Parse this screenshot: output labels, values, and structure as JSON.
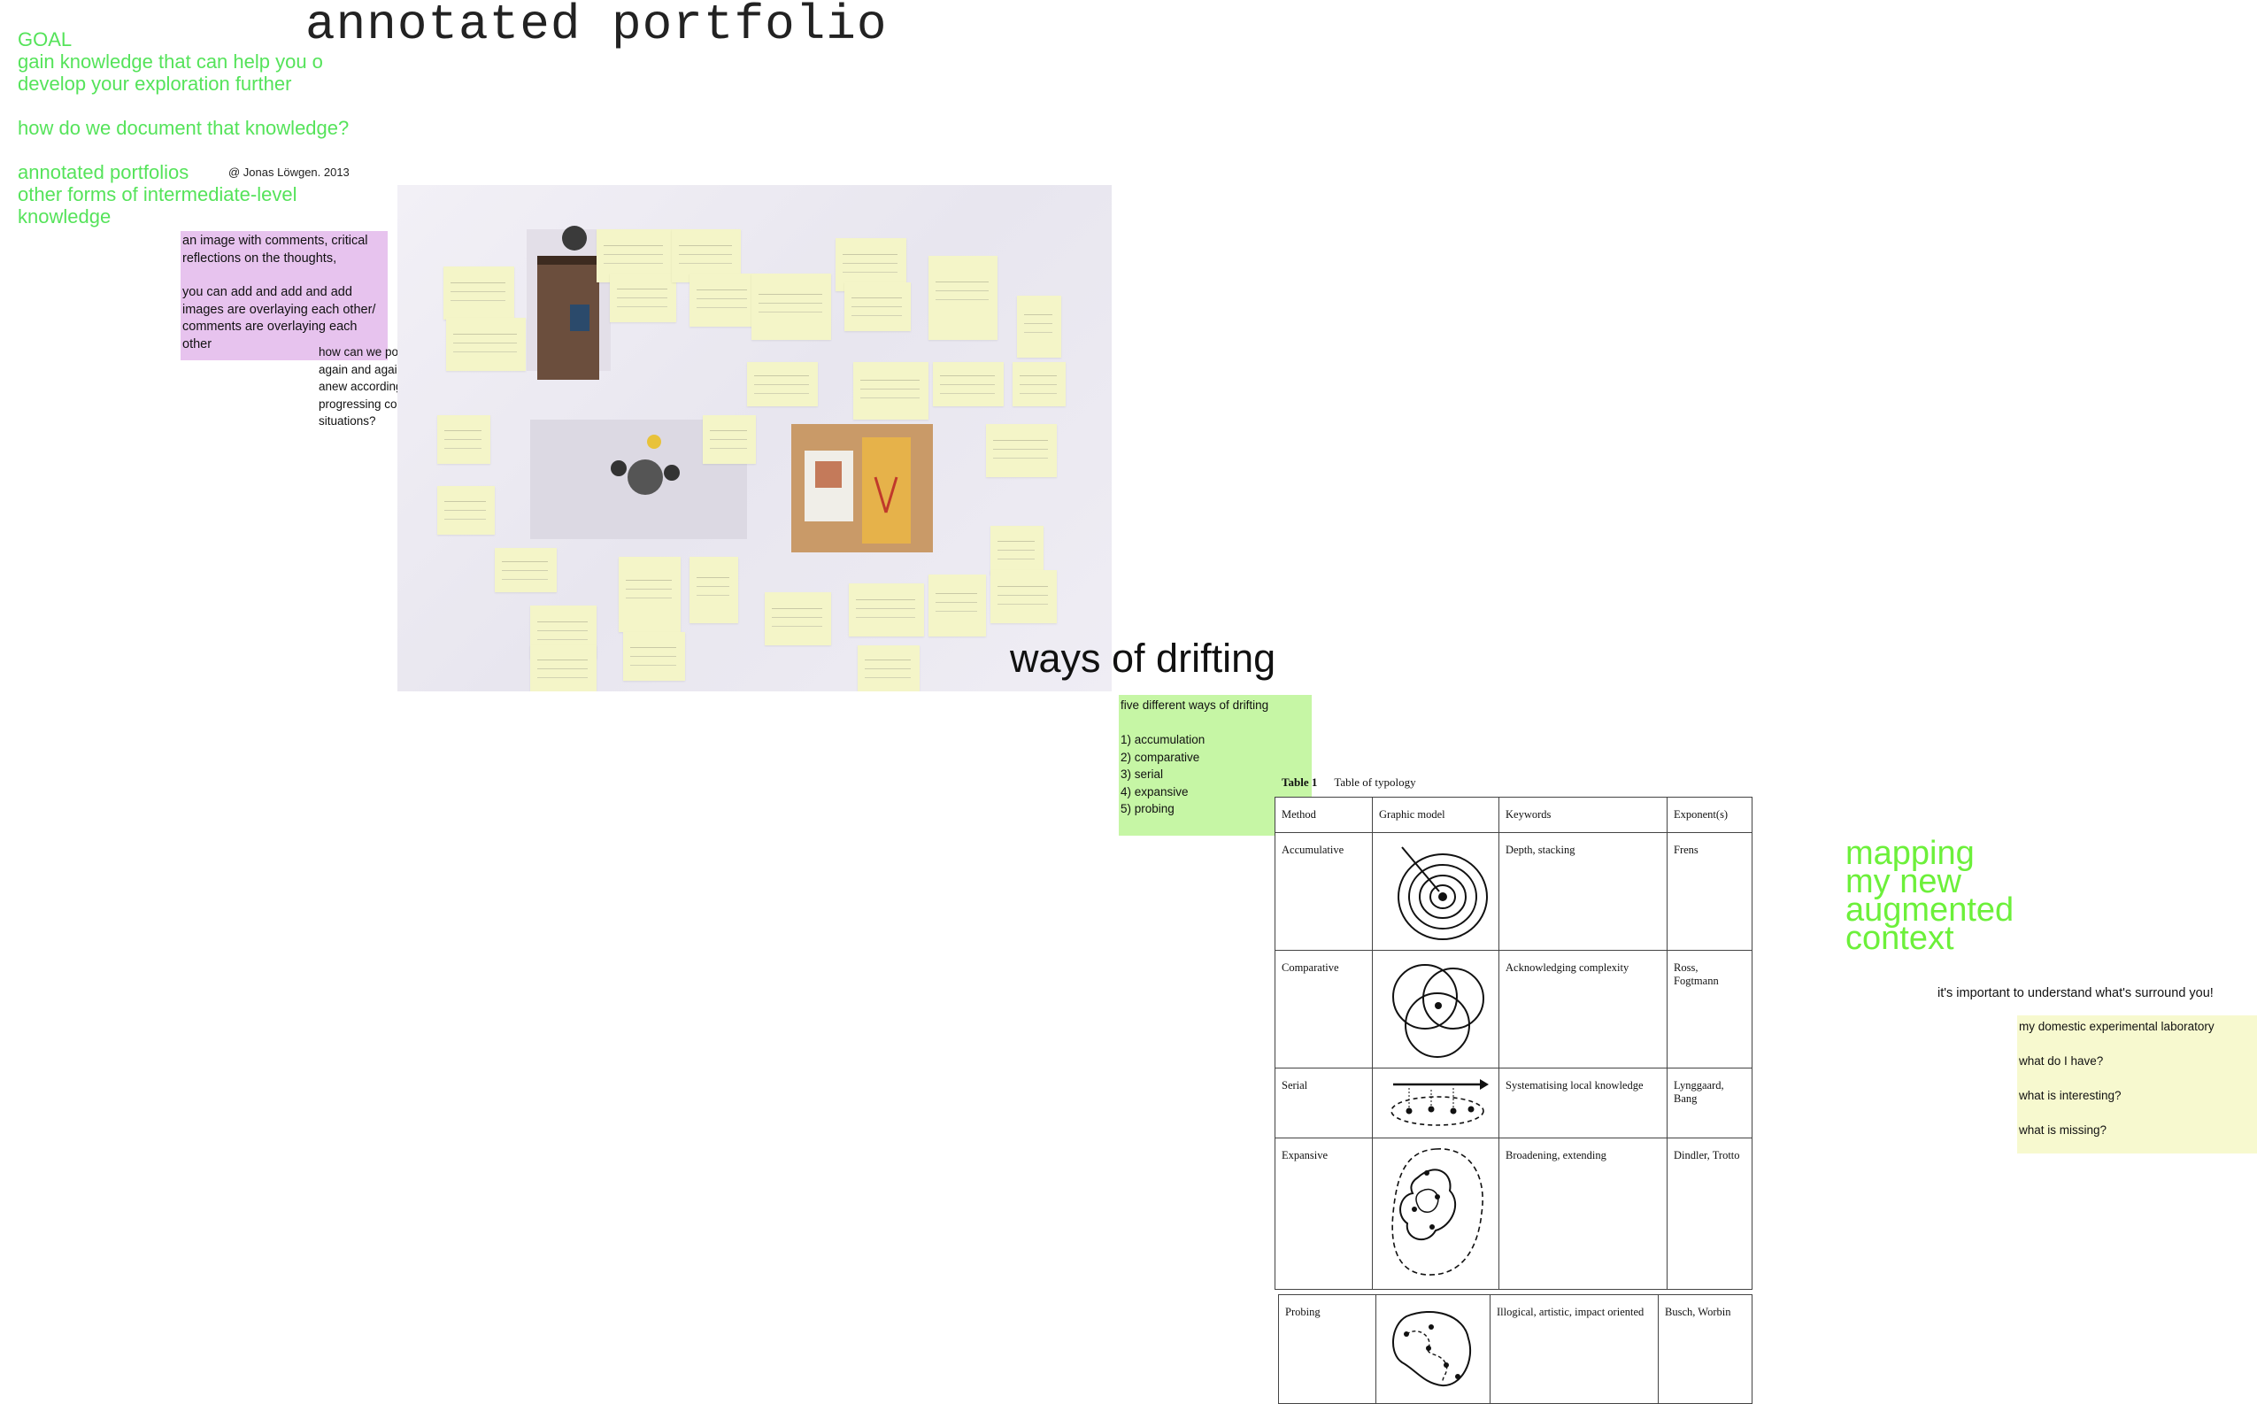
{
  "title": "annotated portfolio",
  "goal": {
    "label": "GOAL",
    "line1": "gain knowledge that can help you o",
    "line2": "develop your exploration further",
    "question": "how do we document that knowledge?",
    "item1": "annotated portfolios",
    "item2": "other forms of intermediate-level",
    "item3": "knowledge"
  },
  "credit": "@ Jonas Löwgen. 2013",
  "pink_note": {
    "p1": "an image with comments, critical reflections on the thoughts,",
    "p2": "you can add and add and add images are overlaying each other/ comments are overlaying each other"
  },
  "position_question": "how can we position ourself again and again, anew and anew according to the progressing context/ situations?",
  "drifting": {
    "title": "ways of drifting",
    "intro": "five different ways of drifting",
    "items": [
      "1) accumulation",
      "2) comparative",
      "3) serial",
      "4) expansive",
      "5) probing"
    ]
  },
  "table": {
    "caption_label": "Table 1",
    "caption_text": "Table of typology",
    "headers": [
      "Method",
      "Graphic model",
      "Keywords",
      "Exponent(s)"
    ],
    "rows": [
      {
        "method": "Accumulative",
        "keywords": "Depth, stacking",
        "exponents": "Frens"
      },
      {
        "method": "Comparative",
        "keywords": "Acknowledging complexity",
        "exponents": "Ross, Fogtmann"
      },
      {
        "method": "Serial",
        "keywords": "Systematising local knowledge",
        "exponents": "Lynggaard, Bang"
      },
      {
        "method": "Expansive",
        "keywords": "Broadening, extending",
        "exponents": "Dindler, Trotto"
      },
      {
        "method": "Probing",
        "keywords": "Illogical, artistic, impact oriented",
        "exponents": "Busch, Worbin"
      }
    ]
  },
  "mapping": {
    "line1": "mapping",
    "line2": "my new",
    "line3": "augmented",
    "line4": "context"
  },
  "surround": "it's important to understand what's surround you!",
  "lab_note": {
    "title": "my domestic experimental laboratory",
    "q1": "what do I have?",
    "q2": "what is interesting?",
    "q3": "what is missing?"
  },
  "colors": {
    "green_text": "#55e35a",
    "mapping_green": "#6cf03a",
    "pink_note": "#e7c3ee",
    "green_note": "#c6f6a5",
    "yellow_note": "#f7f9cf"
  }
}
